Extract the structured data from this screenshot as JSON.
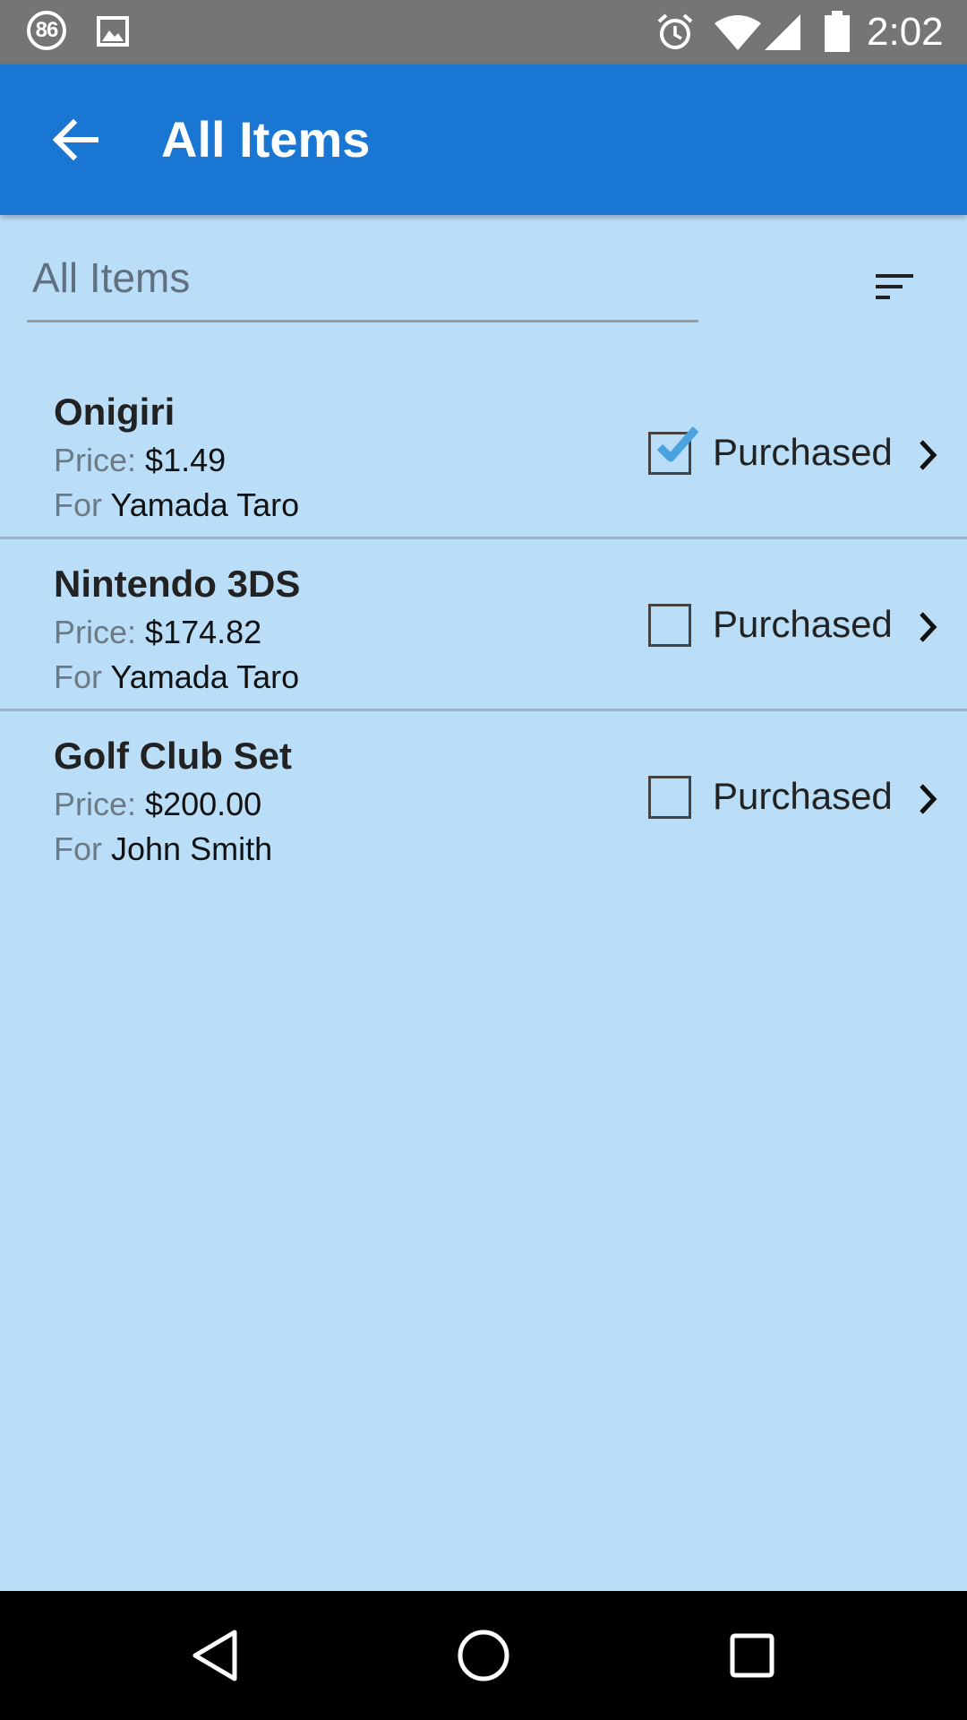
{
  "status_bar": {
    "notification_badge": "86",
    "clock": "2:02",
    "icons": [
      "notification-count-icon",
      "image-icon",
      "alarm-icon",
      "wifi-icon",
      "signal-icon",
      "battery-icon"
    ]
  },
  "app_bar": {
    "title": "All Items",
    "back_icon": "arrow-left-icon",
    "background_color": "#1976d2"
  },
  "filter": {
    "selected": "All Items",
    "sort_icon": "sort-icon"
  },
  "items": [
    {
      "name": "Onigiri",
      "price_label": "Price:",
      "price": "$1.49",
      "for_label": "For",
      "recipient": "Yamada Taro",
      "purchased": true,
      "purchased_label": "Purchased"
    },
    {
      "name": "Nintendo 3DS",
      "price_label": "Price:",
      "price": "$174.82",
      "for_label": "For",
      "recipient": "Yamada Taro",
      "purchased": false,
      "purchased_label": "Purchased"
    },
    {
      "name": "Golf Club Set",
      "price_label": "Price:",
      "price": "$200.00",
      "for_label": "For",
      "recipient": "John Smith",
      "purchased": false,
      "purchased_label": "Purchased"
    }
  ],
  "nav_bar": {
    "icons": [
      "back-triangle-icon",
      "home-circle-icon",
      "recents-square-icon"
    ]
  },
  "colors": {
    "background": "#bbdef8",
    "status_bar": "#757575",
    "nav_bar": "#000000",
    "check_accent": "#4aa3df"
  }
}
